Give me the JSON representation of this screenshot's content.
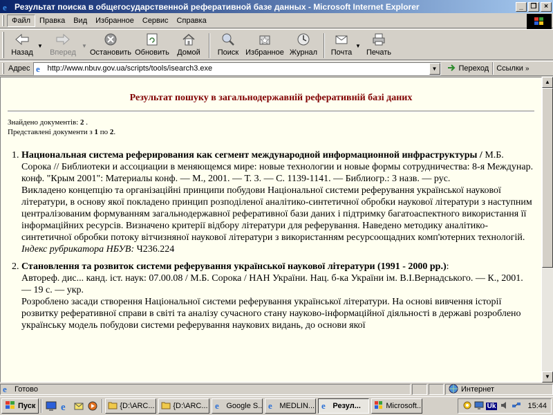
{
  "window": {
    "title": "Результат поиска в общегосударственной реферативной базе данных - Microsoft Internet Explorer",
    "buttons": [
      "_",
      "❐",
      "×"
    ]
  },
  "menu": {
    "items": [
      "Файл",
      "Правка",
      "Вид",
      "Избранное",
      "Сервис",
      "Справка"
    ]
  },
  "toolbar": {
    "back": "Назад",
    "forward": "Вперед",
    "stop": "Остановить",
    "refresh": "Обновить",
    "home": "Домой",
    "search": "Поиск",
    "favorites": "Избранное",
    "history": "Журнал",
    "mail": "Почта",
    "print": "Печать"
  },
  "address": {
    "label": "Адрес",
    "url": "http://www.nbuv.gov.ua/scripts/tools/isearch3.exe",
    "go": "Переход",
    "links": "Ссылки"
  },
  "page": {
    "heading": "Результат пошуку в загальнодержавній реферативній базі даних",
    "found_label": "Знайдено документів:",
    "found_count": "2",
    "found_suffix": " .",
    "shown_label": "Представлені документи з",
    "shown_from": "1",
    "shown_mid": "по",
    "shown_to": "2",
    "shown_suffix": ".",
    "results": [
      {
        "title": "Национальная система реферирования как сегмент международной информационной инфраструктуры /",
        "citation": " М.Б. Сорока // Библиотеки и ассоциации в меняющемся мире: новые технологии и новые формы сотрудничества: 8-я Междунар. конф. \"Крым 2001\": Материалы конф. — М., 2001. — Т. 3. — С. 1139-1141. — Библиогр.: 3 назв. — рус.",
        "abstract": "Викладено концепцію та організаційні принципи побудови Національної системи реферування української наукової літератури, в основу якої покладено принцип розподіленої аналітико-синтетичної обробки наукової літератури з наступним централізованим формуванням загальнодержавної реферативної бази даних і підтримку багатоаспектного використання її інформаційних ресурсів. Визначено критерії відбору літератури для реферування. Наведено методику аналітико-синтетичної обробки потоку вітчизняної наукової літератури з використанням ресурсоощадних комп'ютерних технологій.",
        "index_label": "Індекс рубрикатора НБУВ:",
        "index_value": " Ч236.224"
      },
      {
        "title": "Становлення та розвиток системи реферування української наукової літератури (1991 - 2000 рр.)",
        "title_suffix": ":",
        "citation": "Автореф. дис... канд. іст. наук: 07.00.08 / М.Б. Сорока / НАН України. Нац. б-ка України ім. В.І.Вернадського. — К., 2001. — 19 с. — укр.",
        "abstract": "Розроблено засади створення Національної системи реферування української літератури. На основі вивчення історії розвитку реферативної справи в світі та аналізу сучасного стану науково-інформаційної діяльності в державі розроблено українську модель побудови системи реферування наукових видань, до основи якої"
      }
    ]
  },
  "status": {
    "text": "Готово",
    "zone": "Интернет"
  },
  "taskbar": {
    "start": "Пуск",
    "tasks": [
      "{D:\\ARC...",
      "{D:\\ARC...",
      "Google S...",
      "MEDLIN...",
      "Резул...",
      "Microsoft..."
    ],
    "active_index": 4,
    "lang": "Uk",
    "clock": "15:44"
  }
}
